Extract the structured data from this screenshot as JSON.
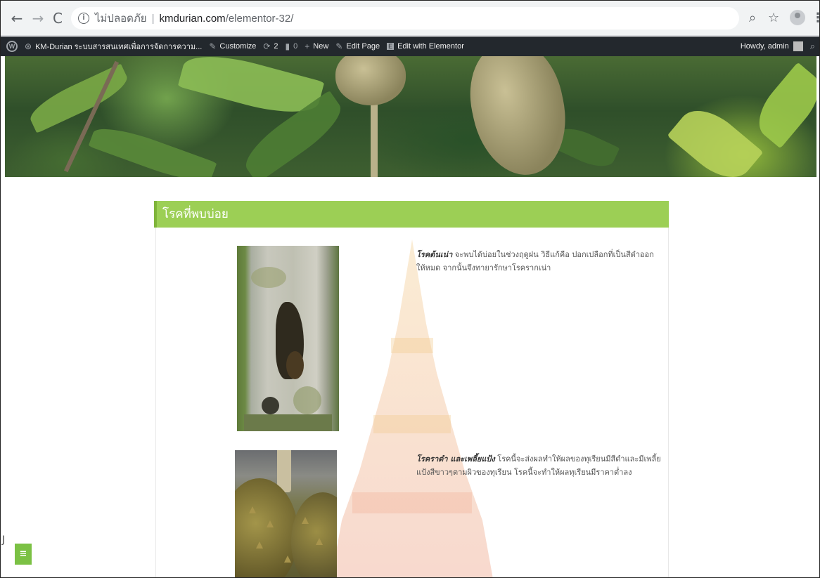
{
  "browser": {
    "insecure_label": "ไม่ปลอดภัย",
    "url_host": "kmdurian.com",
    "url_path": "/elementor-32/"
  },
  "adminbar": {
    "site_name": "KM-Durian ระบบสารสนเทศเพื่อการจัดการความ...",
    "customize": "Customize",
    "updates_count": "2",
    "comments_count": "0",
    "new": "New",
    "edit_page": "Edit Page",
    "edit_elementor": "Edit with Elementor",
    "howdy": "Howdy, admin"
  },
  "section": {
    "heading": "โรคที่พบบ่อย"
  },
  "diseases": [
    {
      "name": "โรคต้นเน่า",
      "text": " จะพบได้บ่อยในช่วงฤดูฝน วิธีแก้คือ ปอกเปลือกที่เป็นสีดำออกให้หมด จากนั้นจึงทายารักษาโรครากเน่า"
    },
    {
      "name": "โรคราดำ และเพลี้ยแป้ง",
      "text": " โรคนี้จะส่งผลทำให้ผลของทุเรียนมีสีดำและมีเพลี้ยแป้งสีขาวๆตามผิวของทุเรียน โรคนี้จะทำให้ผลทุเรียนมีราคาต่ำลง"
    }
  ],
  "side_button_label": "≡",
  "left_glyph": "J"
}
